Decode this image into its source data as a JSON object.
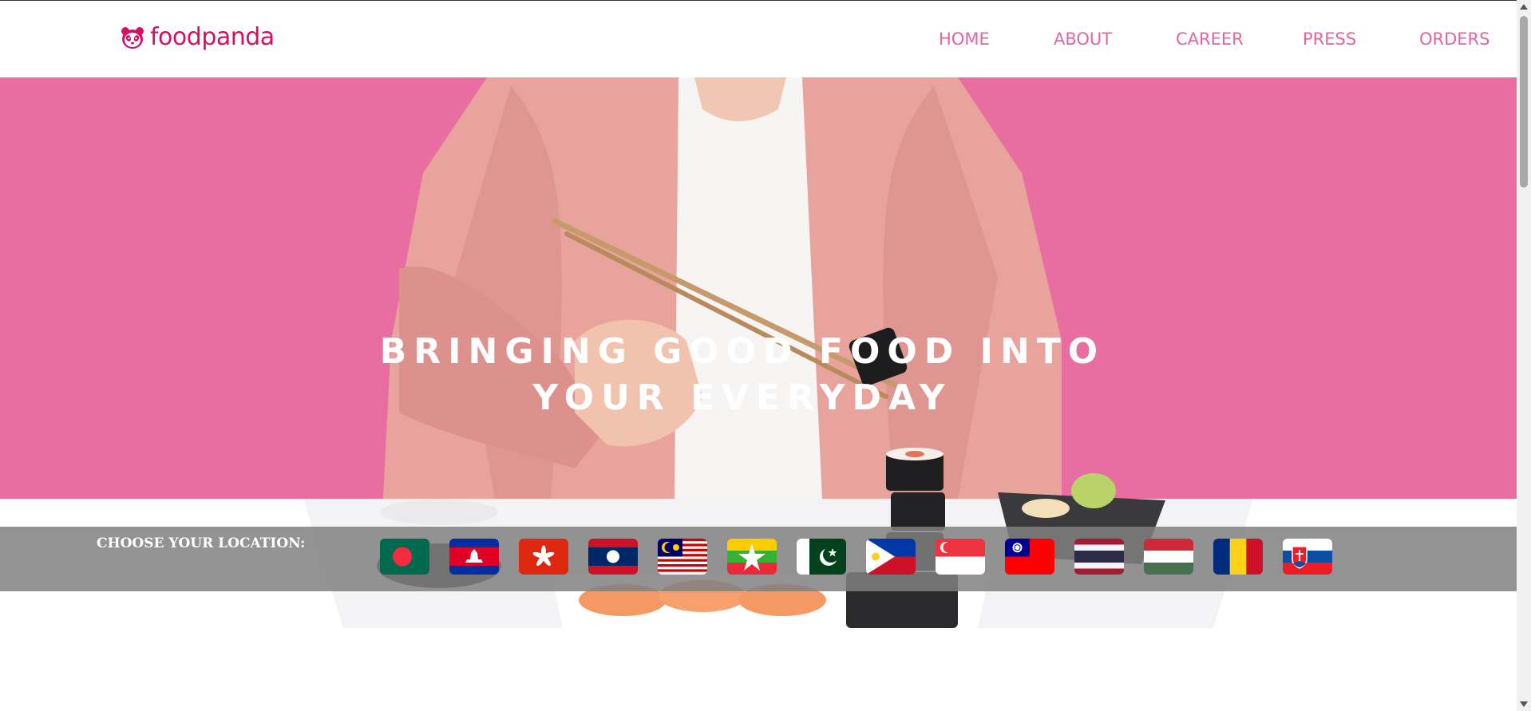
{
  "brand": {
    "name": "foodpanda",
    "color": "#d70f64",
    "icon": "panda-icon"
  },
  "nav": {
    "items": [
      {
        "label": "HOME",
        "name": "nav-home"
      },
      {
        "label": "ABOUT",
        "name": "nav-about"
      },
      {
        "label": "CAREER",
        "name": "nav-career"
      },
      {
        "label": "PRESS",
        "name": "nav-press"
      },
      {
        "label": "ORDERS",
        "name": "nav-orders"
      }
    ],
    "color": "#e2669f"
  },
  "hero": {
    "title": "BRINGING GOOD FOOD INTO YOUR EVERYDAY",
    "background": "#e86ea2"
  },
  "location": {
    "label": "CHOOSE YOUR LOCATION:",
    "flags": [
      "bangladesh-flag",
      "cambodia-flag",
      "hong-kong-flag",
      "laos-flag",
      "malaysia-flag",
      "myanmar-flag",
      "pakistan-flag",
      "philippines-flag",
      "singapore-flag",
      "taiwan-flag",
      "thailand-flag",
      "hungary-flag",
      "romania-flag",
      "slovakia-flag"
    ]
  }
}
